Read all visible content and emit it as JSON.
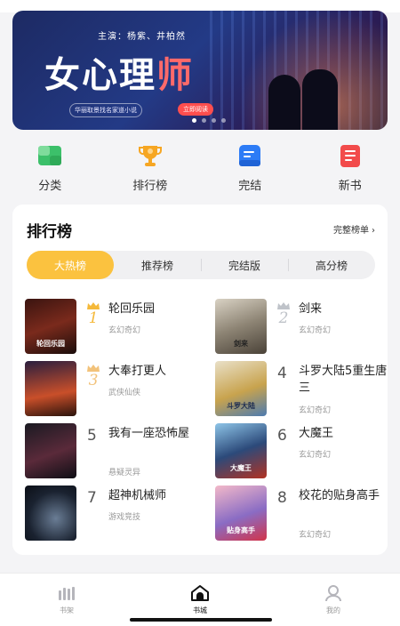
{
  "banner": {
    "subtitle": "主演：杨紫、井柏然",
    "title_part1": "女心理",
    "title_part2": "师",
    "tagline": "华丽取景找名家道小说",
    "read_button": "立即阅读",
    "slide_count": 4,
    "active_slide": 1
  },
  "quick_nav": [
    {
      "label": "分类",
      "icon": "category-icon",
      "color": "#3cc06a"
    },
    {
      "label": "排行榜",
      "icon": "trophy-icon",
      "color": "#f6a623"
    },
    {
      "label": "完结",
      "icon": "completed-icon",
      "color": "#2d7cf6"
    },
    {
      "label": "新书",
      "icon": "new-book-icon",
      "color": "#f24b4b"
    }
  ],
  "ranking": {
    "title": "排行榜",
    "more_label": "完整榜单",
    "tabs": [
      "大热榜",
      "推荐榜",
      "完结版",
      "高分榜"
    ],
    "active_tab": 0,
    "books": [
      {
        "rank": "1",
        "title": "轮回乐园",
        "genre": "玄幻奇幻",
        "cover_text": "轮回乐园"
      },
      {
        "rank": "2",
        "title": "剑来",
        "genre": "玄幻奇幻",
        "cover_text": "剑来"
      },
      {
        "rank": "3",
        "title": "大奉打更人",
        "genre": "武侠仙侠",
        "cover_text": ""
      },
      {
        "rank": "4",
        "title": "斗罗大陆5重生唐三",
        "genre": "玄幻奇幻",
        "cover_text": "斗罗大陆"
      },
      {
        "rank": "5",
        "title": "我有一座恐怖屋",
        "genre": "悬疑灵异",
        "cover_text": ""
      },
      {
        "rank": "6",
        "title": "大魔王",
        "genre": "玄幻奇幻",
        "cover_text": "大魔王"
      },
      {
        "rank": "7",
        "title": "超神机械师",
        "genre": "游戏竞技",
        "cover_text": ""
      },
      {
        "rank": "8",
        "title": "校花的贴身高手",
        "genre": "玄幻奇幻",
        "cover_text": "贴身高手"
      }
    ]
  },
  "tabbar": [
    {
      "label": "书架",
      "icon": "bookshelf-icon"
    },
    {
      "label": "书城",
      "icon": "bookstore-icon"
    },
    {
      "label": "我的",
      "icon": "profile-icon"
    }
  ],
  "active_tabbar": 1,
  "colors": {
    "accent": "#fbc23f",
    "gold": "#f5b93a",
    "silver": "#bfc3c9"
  }
}
